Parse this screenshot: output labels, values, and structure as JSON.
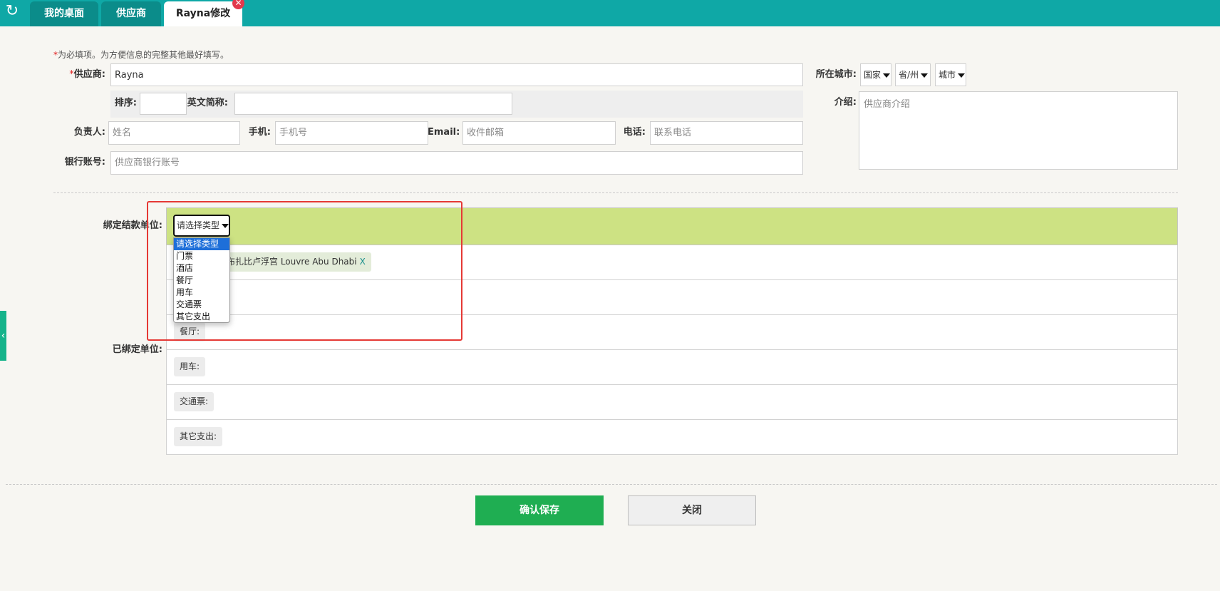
{
  "tabs": [
    {
      "label": "我的桌面"
    },
    {
      "label": "供应商"
    },
    {
      "label": "Rayna修改"
    }
  ],
  "icons": {
    "refresh": "↻",
    "close": "✕",
    "side_arrow": "‹"
  },
  "form": {
    "required_mark": "*",
    "required_hint": "为必填项。为方便信息的完整其他最好填写。",
    "supplier_label": "供应商:",
    "supplier_value": "Rayna",
    "sort_label": "排序:",
    "sort_value": "",
    "en_short_label": "英文简称:",
    "en_short_value": "",
    "contact_label": "负责人:",
    "contact_placeholder": "姓名",
    "mobile_label": "手机:",
    "mobile_placeholder": "手机号",
    "email_label": "Email:",
    "email_placeholder": "收件邮箱",
    "phone_label": "电话:",
    "phone_placeholder": "联系电话",
    "bank_label": "银行账号:",
    "bank_placeholder": "供应商银行账号",
    "city_label": "所在城市:",
    "country": "国家",
    "province": "省/州",
    "city": "城市",
    "intro_label": "介绍:",
    "intro_placeholder": "供应商介绍"
  },
  "binding": {
    "bind_label": "绑定结款单位:",
    "bound_label": "已绑定单位:",
    "select_value": "请选择类型",
    "options": [
      "请选择类型",
      "门票",
      "酒店",
      "餐厅",
      "用车",
      "交通票",
      "其它支出"
    ],
    "selected_index": 0,
    "bound_tag_visible_text": "布扎比卢浮宫 Louvre Abu Dhabi",
    "bound_tag_remove": "X",
    "rows": [
      {
        "pill": "餐厅:"
      },
      {
        "pill": "用车:"
      },
      {
        "pill": "交通票:"
      },
      {
        "pill": "其它支出:"
      }
    ]
  },
  "actions": {
    "save": "确认保存",
    "close": "关闭"
  },
  "colors": {
    "header": "#0fa8a6",
    "save": "#1fae52",
    "bind_header": "#cde283",
    "highlight": "#e53935"
  }
}
